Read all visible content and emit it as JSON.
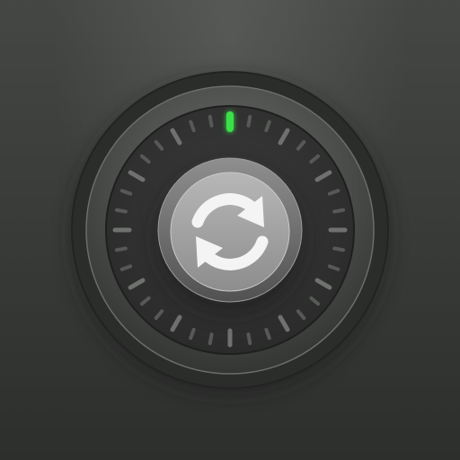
{
  "app": {
    "icon_type": "rotary-dial-sync-icon",
    "indicator_color": "#3be04a",
    "background_color": "#3a3b3a",
    "knob_color": "#9a9a9a",
    "symbol": "sync-arrows-icon"
  },
  "dial": {
    "active_tick": "top",
    "tick_count": 36
  }
}
